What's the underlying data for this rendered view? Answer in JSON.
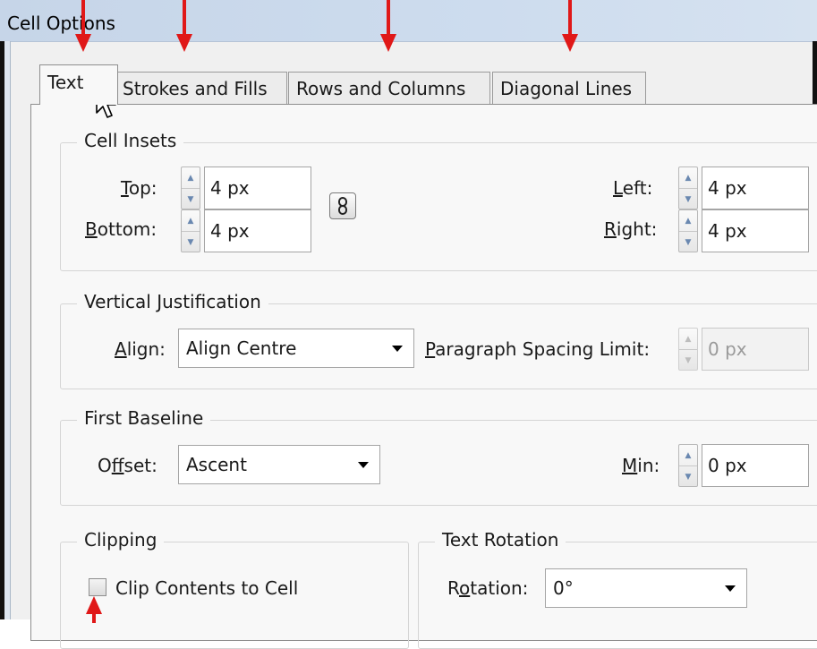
{
  "window": {
    "title": "Cell Options"
  },
  "tabs": [
    {
      "label": "Text",
      "active": true
    },
    {
      "label": "Strokes and Fills",
      "active": false
    },
    {
      "label": "Rows and Columns",
      "active": false
    },
    {
      "label": "Diagonal Lines",
      "active": false
    }
  ],
  "cell_insets": {
    "title": "Cell Insets",
    "top": {
      "label": "Top:",
      "mnemonic": "T",
      "value": "4 px"
    },
    "bottom": {
      "label": "Bottom:",
      "mnemonic": "B",
      "value": "4 px"
    },
    "left": {
      "label": "Left:",
      "mnemonic": "L",
      "value": "4 px"
    },
    "right": {
      "label": "Right:",
      "mnemonic": "R",
      "value": "4 px"
    }
  },
  "vertical_justification": {
    "title": "Vertical Justification",
    "align_label": "Align:",
    "align_value": "Align Centre",
    "paragraph_spacing_label": "Paragraph Spacing Limit:",
    "paragraph_spacing_value": "0 px"
  },
  "first_baseline": {
    "title": "First Baseline",
    "offset_label": "Offset:",
    "offset_value": "Ascent",
    "min_label": "Min:",
    "min_value": "0 px"
  },
  "clipping": {
    "title": "Clipping",
    "checkbox_label": "Clip Contents to Cell",
    "checked": false
  },
  "text_rotation": {
    "title": "Text Rotation",
    "rotation_label": "Rotation:",
    "rotation_value": "0°"
  },
  "colors": {
    "arrow": "#e01818",
    "titlebar": "#cddcee"
  }
}
